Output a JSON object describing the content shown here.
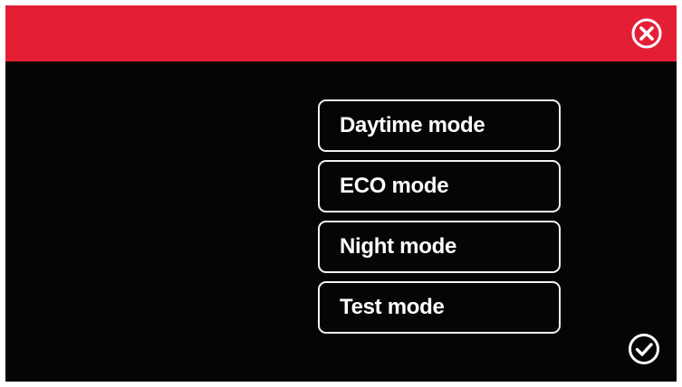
{
  "header": {
    "bar_color": "#e41f35",
    "close_icon": "close-circle-icon"
  },
  "modes": {
    "items": [
      {
        "label": "Daytime mode"
      },
      {
        "label": "ECO mode"
      },
      {
        "label": "Night mode"
      },
      {
        "label": "Test mode"
      }
    ]
  },
  "footer": {
    "confirm_icon": "checkmark-circle-icon"
  },
  "colors": {
    "background": "#050505",
    "accent": "#e41f35",
    "text": "#ffffff"
  }
}
